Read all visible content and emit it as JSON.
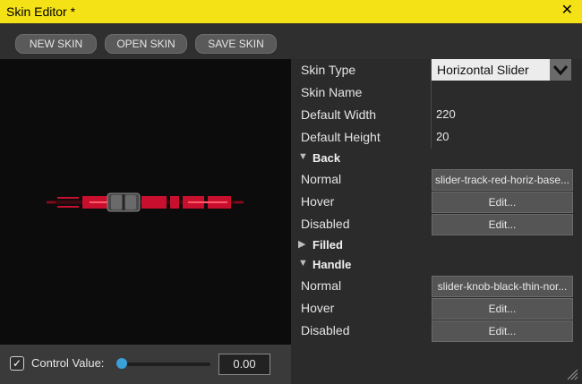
{
  "window": {
    "title": "Skin Editor *",
    "close_glyph": "✕"
  },
  "toolbar": {
    "new_label": "NEW SKIN",
    "open_label": "OPEN SKIN",
    "save_label": "SAVE SKIN"
  },
  "control": {
    "checked_glyph": "✓",
    "label": "Control Value:",
    "value_text": "0.00",
    "slider_value": 0.0
  },
  "props": {
    "skin_type_label": "Skin Type",
    "skin_type_value": "Horizontal Slider",
    "skin_name_label": "Skin Name",
    "skin_name_value": "",
    "default_width_label": "Default Width",
    "default_width_value": "220",
    "default_height_label": "Default Height",
    "default_height_value": "20",
    "back": {
      "title": "Back",
      "normal_label": "Normal",
      "normal_value": "slider-track-red-horiz-base...",
      "hover_label": "Hover",
      "hover_value": "Edit...",
      "disabled_label": "Disabled",
      "disabled_value": "Edit..."
    },
    "filled": {
      "title": "Filled"
    },
    "handle": {
      "title": "Handle",
      "normal_label": "Normal",
      "normal_value": "slider-knob-black-thin-nor...",
      "hover_label": "Hover",
      "hover_value": "Edit...",
      "disabled_label": "Disabled",
      "disabled_value": "Edit..."
    }
  },
  "colors": {
    "accent": "#f4e216",
    "track_red": "#c8102e",
    "slider_knob": "#3aa0d8"
  },
  "icons": {
    "expanded": "triangle-down-icon",
    "collapsed": "triangle-right-icon",
    "dropdown": "chevron-down-icon",
    "resize": "resize-grip-icon"
  }
}
